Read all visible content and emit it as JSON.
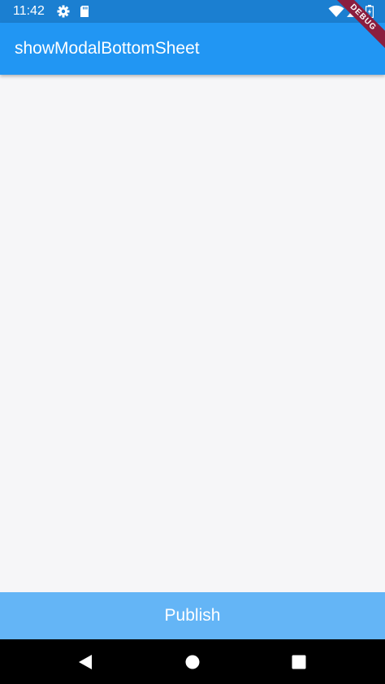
{
  "status_bar": {
    "time": "11:42",
    "icons": [
      "gear-icon",
      "sd-card-icon",
      "wifi-icon",
      "signal-icon",
      "battery-icon"
    ]
  },
  "app_bar": {
    "title": "showModalBottomSheet"
  },
  "debug_banner": {
    "label": "DEBUG"
  },
  "bottom_button": {
    "label": "Publish"
  },
  "navigation_bar": {
    "icons": [
      "back-icon",
      "home-icon",
      "recents-icon"
    ]
  },
  "colors": {
    "status_bar": "#1b7fd1",
    "app_bar": "#2196f3",
    "body_background": "#f6f6f8",
    "button": "#64b5f6",
    "debug_ribbon": "#8b1e3f",
    "navigation_bar": "#000000"
  }
}
